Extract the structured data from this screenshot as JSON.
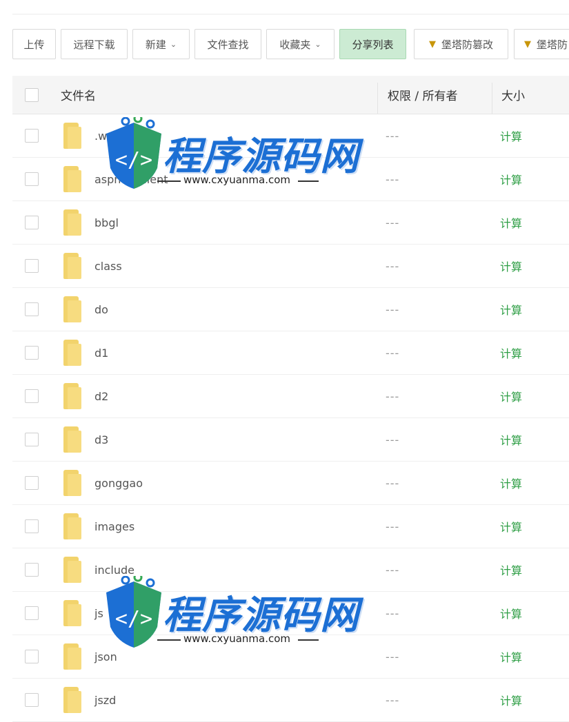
{
  "toolbar": {
    "upload": "上传",
    "remote_download": "远程下载",
    "new": "新建",
    "file_search": "文件查找",
    "favorites": "收藏夹",
    "share_list": "分享列表",
    "tamper_proof_1": "堡塔防篡改",
    "tamper_proof_2": "堡塔防"
  },
  "table": {
    "headers": {
      "name": "文件名",
      "permission": "权限 / 所有者",
      "size": "大小"
    },
    "rows": [
      {
        "name": ".w",
        "perm": "---",
        "size": "计算"
      },
      {
        "name": "aspnet_client",
        "perm": "---",
        "size": "计算"
      },
      {
        "name": "bbgl",
        "perm": "---",
        "size": "计算"
      },
      {
        "name": "class",
        "perm": "---",
        "size": "计算"
      },
      {
        "name": "do",
        "perm": "---",
        "size": "计算"
      },
      {
        "name": "d1",
        "perm": "---",
        "size": "计算"
      },
      {
        "name": "d2",
        "perm": "---",
        "size": "计算"
      },
      {
        "name": "d3",
        "perm": "---",
        "size": "计算"
      },
      {
        "name": "gonggao",
        "perm": "---",
        "size": "计算"
      },
      {
        "name": "images",
        "perm": "---",
        "size": "计算"
      },
      {
        "name": "include",
        "perm": "---",
        "size": "计算"
      },
      {
        "name": "js",
        "perm": "---",
        "size": "计算"
      },
      {
        "name": "json",
        "perm": "---",
        "size": "计算"
      },
      {
        "name": "jszd",
        "perm": "---",
        "size": "计算"
      }
    ]
  },
  "watermark": {
    "brand": "程序源码网",
    "url": "www.cxyuanma.com"
  },
  "colors": {
    "accent_green": "#2e9e45",
    "active_button": "#ccebd3",
    "folder": "#f7dc80",
    "watermark_blue": "#1c6fd4"
  },
  "icons": {
    "dropdown": "chevron-down-icon",
    "folder": "folder-icon",
    "gem": "diamond-icon"
  }
}
